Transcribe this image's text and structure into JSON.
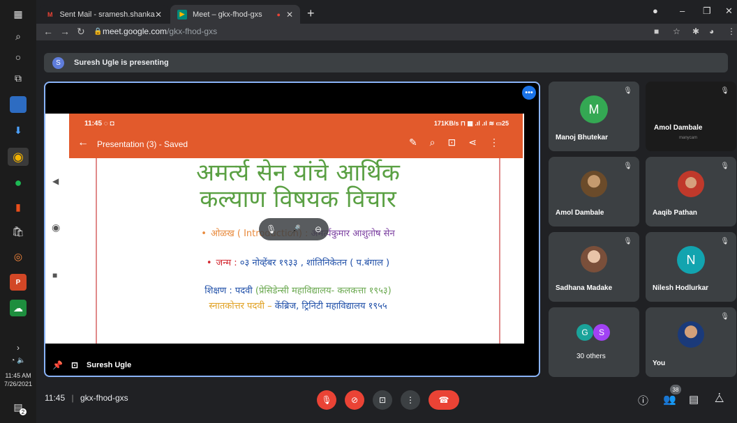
{
  "browser": {
    "tabs": [
      {
        "label": "Sent Mail - sramesh.shankarrao@",
        "favicon": "gmail-icon"
      },
      {
        "label": "Meet – gkx-fhod-gxs",
        "favicon": "meet-icon"
      }
    ],
    "url_host": "meet.google.com",
    "url_path": "/gkx-fhod-gxs"
  },
  "taskbar": {
    "time": "11:45 AM",
    "date": "7/26/2021",
    "notification_count": "2"
  },
  "meet": {
    "presenting_avatar": "S",
    "presenting_text": "Suresh Ugle is presenting",
    "presenter_name": "Suresh Ugle",
    "meeting_time": "11:45",
    "separator": "|",
    "meeting_code": "gkx-fhod-gxs",
    "participant_count": "38",
    "colors": {
      "accent": "#8ab4f8",
      "end_call": "#ea4335",
      "muted": "#ea4335",
      "tile_bg": "#3c4043"
    }
  },
  "phone": {
    "status_time": "11:45",
    "status_right": "171KB/s",
    "battery": "25",
    "app_title": "Presentation (3) - Saved"
  },
  "slide": {
    "title_line1": "अमर्त्य सेन यांचे आर्थिक",
    "title_line2": "कल्याण विषयक विचार",
    "intro_label": "ओळख ( Introduction) : ",
    "intro_value": "अमर्त्यकुमार आशुतोष सेन",
    "birth_label": "जन्म : ",
    "birth_value": "०३ नोव्हेंबर १९३३ , शांतिनिकेतन ( प.बंगाल )",
    "edu_label": "शिक्षण : पदवी ",
    "edu_value": "(प्रेसिडेन्सी महाविद्यालय- कलकत्ता १९५३)",
    "pg_label": "स्नातकोत्तर पदवी – ",
    "pg_value": "केंब्रिज, ट्रिनिटी महाविद्यालय १९५५"
  },
  "participants": [
    {
      "name": "Manoj Bhutekar",
      "letter": "M",
      "color": "#34a853"
    },
    {
      "name": "Amol Dambale",
      "sub": "manycam"
    },
    {
      "name": "Amol Dambale",
      "photo": true
    },
    {
      "name": "Aaqib Pathan",
      "photo": true
    },
    {
      "name": "Sadhana Madake",
      "photo": true
    },
    {
      "name": "Nilesh Hodlurkar",
      "letter": "N",
      "color": "#12a4af"
    },
    {
      "name": "30 others",
      "letters": [
        "G",
        "S"
      ]
    },
    {
      "name": "You",
      "photo": true
    }
  ]
}
